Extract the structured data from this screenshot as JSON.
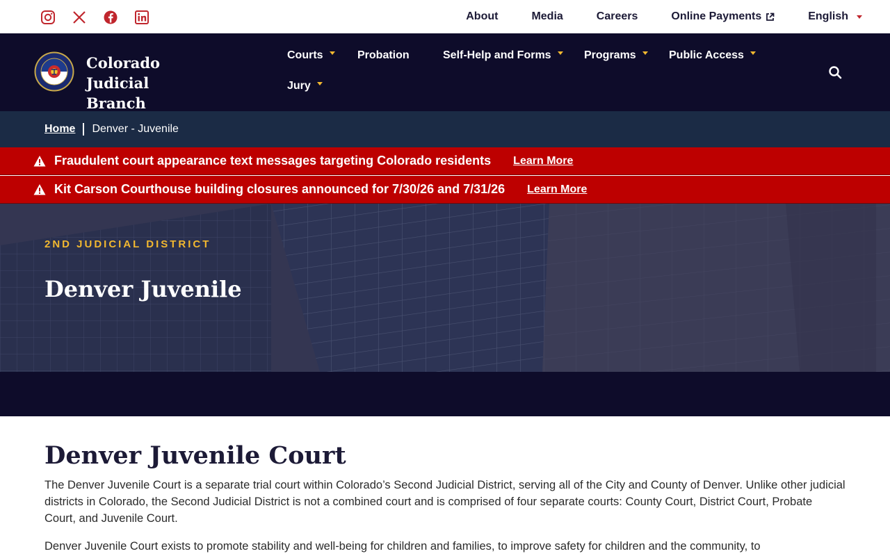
{
  "social": [
    {
      "name": "instagram-icon"
    },
    {
      "name": "x-icon"
    },
    {
      "name": "facebook-icon"
    },
    {
      "name": "linkedin-icon"
    }
  ],
  "utility": {
    "about": "About",
    "media": "Media",
    "careers": "Careers",
    "payments": "Online Payments",
    "language": "English"
  },
  "brand": {
    "line1": "Colorado Judicial",
    "line2": "Branch"
  },
  "nav": {
    "courts": "Courts",
    "probation": "Probation",
    "self_help": "Self-Help and Forms",
    "programs": "Programs",
    "public_access": "Public Access",
    "jury": "Jury"
  },
  "breadcrumb": {
    "home": "Home",
    "current": "Denver - Juvenile"
  },
  "alerts": [
    {
      "message": "Fraudulent court appearance text messages targeting Colorado residents",
      "link": "Learn More"
    },
    {
      "message": "Kit Carson Courthouse building closures announced for 7/30/26 and 7/31/26",
      "link": "Learn More"
    }
  ],
  "hero": {
    "kicker": "2ND JUDICIAL DISTRICT",
    "title": "Denver Juvenile"
  },
  "content": {
    "heading": "Denver Juvenile Court",
    "p1": "The Denver Juvenile Court is a separate trial court within Colorado’s Second Judicial District, serving all of the City and County of Denver. Unlike other judicial districts in Colorado, the Second Judicial District is not a combined court and is comprised of four separate courts: County Court, District Court, Probate Court, and Juvenile Court.",
    "p2": "Denver Juvenile Court exists to promote stability and well-being for children and families, to improve safety for children and the community, to"
  },
  "colors": {
    "navy": "#0e0c2a",
    "breadcrumb_bg": "#1b2b45",
    "alert_red": "#bd0000",
    "gold": "#f2b830",
    "social_red": "#c0262d"
  }
}
